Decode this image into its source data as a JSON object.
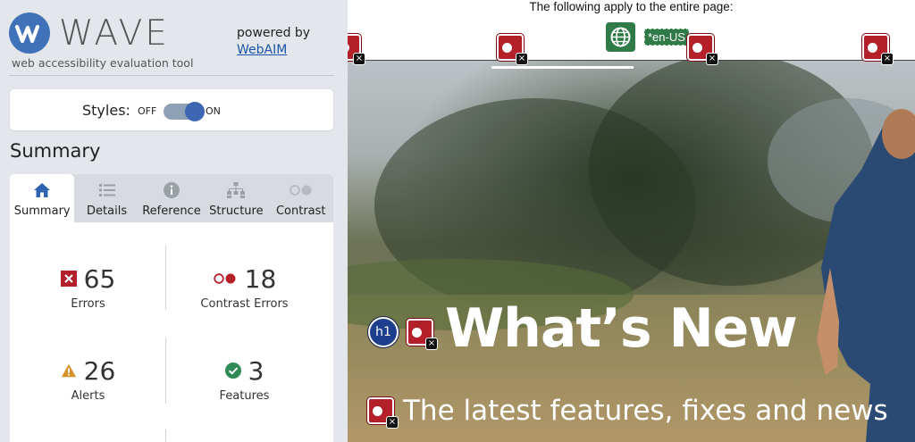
{
  "sidebar": {
    "logo": {
      "name": "WAVE",
      "tagline": "web accessibility evaluation tool"
    },
    "powered_by": {
      "label": "powered by",
      "link": "WebAIM"
    },
    "styles_toggle": {
      "label": "Styles:",
      "off": "OFF",
      "on": "ON",
      "state": "on"
    },
    "summary_heading": "Summary",
    "tabs": [
      {
        "label": "Summary",
        "icon": "home-icon",
        "active": true
      },
      {
        "label": "Details",
        "icon": "list-icon",
        "active": false
      },
      {
        "label": "Reference",
        "icon": "info-icon",
        "active": false
      },
      {
        "label": "Structure",
        "icon": "structure-icon",
        "active": false
      },
      {
        "label": "Contrast",
        "icon": "contrast-icon",
        "active": false
      }
    ],
    "stats": {
      "errors": {
        "value": "65",
        "label": "Errors",
        "icon": "error-icon"
      },
      "contrast_errors": {
        "value": "18",
        "label": "Contrast Errors",
        "icon": "contrast-error-icon"
      },
      "alerts": {
        "value": "26",
        "label": "Alerts",
        "icon": "alert-icon"
      },
      "features": {
        "value": "3",
        "label": "Features",
        "icon": "feature-icon"
      }
    }
  },
  "preview": {
    "page_level_text": "The following apply to the entire page:",
    "lang_badge": "*en-US",
    "h1_badge": "h1",
    "hero_title": "What’s New",
    "hero_subtitle": "The latest features, fixes and news"
  },
  "colors": {
    "sidebar_bg": "#e3e6ea",
    "brand_blue": "#3f72b8",
    "link_blue": "#1a54a8",
    "error_red": "#b3202a",
    "alert_orange": "#d6922a",
    "feature_green": "#2f8a55",
    "heading_blue": "#1c3e8c"
  }
}
